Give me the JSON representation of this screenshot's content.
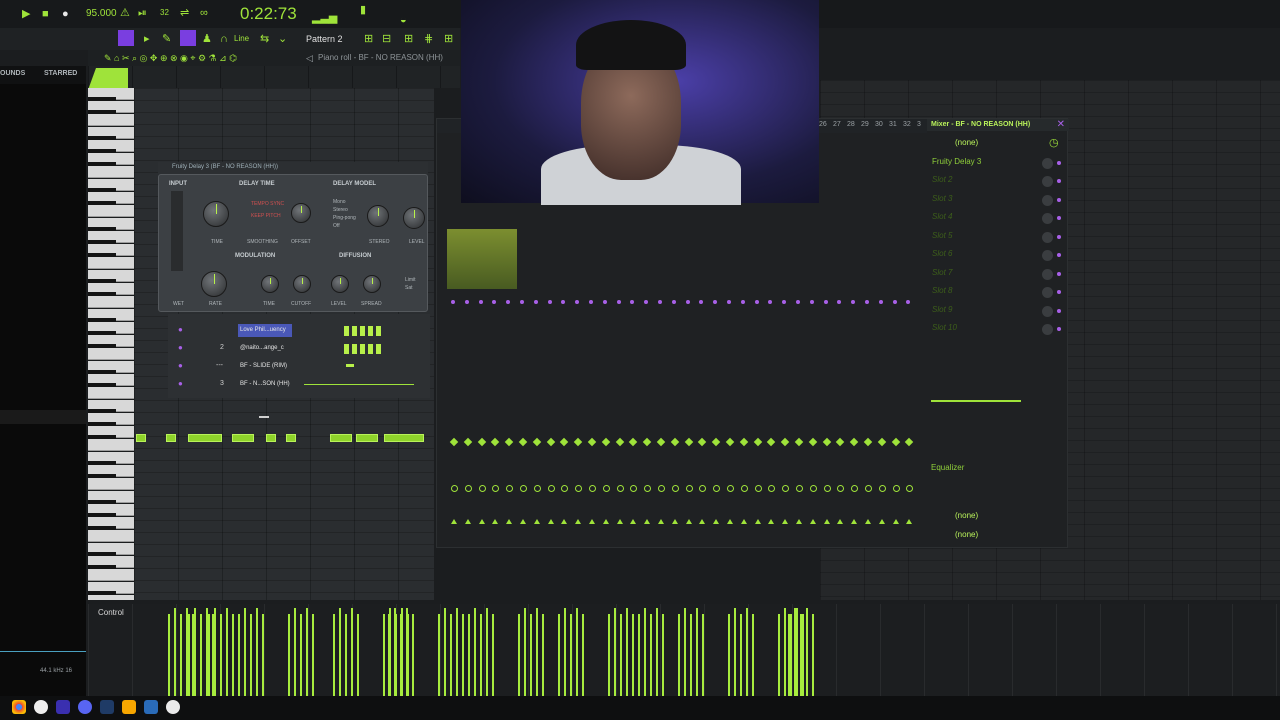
{
  "transport": {
    "tempo": "95.000",
    "time": "0:22:73",
    "snap": "Line",
    "pattern": "Pattern 2",
    "rate": "32"
  },
  "piano_roll": {
    "title": "Piano roll - BF - NO REASON (HH)",
    "control_label": "Control"
  },
  "browser": {
    "tabs": [
      "OUNDS",
      "STARRED"
    ],
    "status": "44.1 kHz 16"
  },
  "delay": {
    "title": "Fruity Delay 3 (BF - NO REASON (HH))",
    "sections": {
      "input": "INPUT",
      "delay_time": "DELAY TIME",
      "delay_model": "DELAY MODEL",
      "modulation": "MODULATION",
      "diffusion": "DIFFUSION"
    },
    "options": {
      "tempo_sync": "TEMPO SYNC",
      "keep_pitch": "KEEP PITCH",
      "mono": "Mono",
      "stereo_opt": "Stereo",
      "ping_pong": "Ping-pong",
      "off": "Off",
      "limit": "Limit",
      "sat": "Sat"
    },
    "knobs": {
      "time": "TIME",
      "smoothing": "SMOOTHING",
      "offset": "OFFSET",
      "stereo": "STEREO",
      "level_top": "LEVEL",
      "rate": "RATE",
      "time2": "TIME",
      "cutoff": "CUTOFF",
      "level2": "LEVEL",
      "spread": "SPREAD",
      "wet": "WET"
    }
  },
  "channel_rack": {
    "rows": [
      {
        "num": "",
        "name": "Love Phil...uency"
      },
      {
        "num": "2",
        "name": "@naito...ange_c"
      },
      {
        "num": "---",
        "name": "BF - SLIDE (RIM)"
      },
      {
        "num": "3",
        "name": "BF - N...SON (HH)"
      }
    ]
  },
  "mixer": {
    "title": "Mixer - BF - NO REASON (HH)",
    "preset": "(none)",
    "slots": [
      "Fruity Delay 3",
      "Slot 2",
      "Slot 3",
      "Slot 4",
      "Slot 5",
      "Slot 6",
      "Slot 7",
      "Slot 8",
      "Slot 9",
      "Slot 10"
    ],
    "equalizer": "Equalizer",
    "out_a": "(none)",
    "out_b": "(none)",
    "header_numbers": [
      "26",
      "27",
      "28",
      "29",
      "30",
      "31",
      "32",
      "3"
    ]
  },
  "accent": "#9fe33a",
  "purple": "#a860e8"
}
